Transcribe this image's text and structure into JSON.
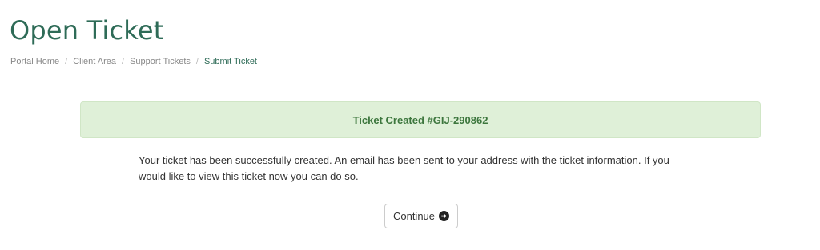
{
  "page": {
    "title": "Open Ticket"
  },
  "breadcrumb": {
    "items": [
      {
        "label": "Portal Home"
      },
      {
        "label": "Client Area"
      },
      {
        "label": "Support Tickets"
      },
      {
        "label": "Submit Ticket"
      }
    ],
    "separator": "/"
  },
  "alert": {
    "text": "Ticket Created #GIJ-290862",
    "color": "#3c763d",
    "background": "#dff0d8"
  },
  "message": {
    "text": "Your ticket has been successfully created. An email has been sent to your address with the ticket information. If you would like to view this ticket now you can do so."
  },
  "actions": {
    "continue_label": "Continue",
    "continue_icon": "arrow-circle-right-icon"
  },
  "colors": {
    "accent": "#2e6b57"
  }
}
